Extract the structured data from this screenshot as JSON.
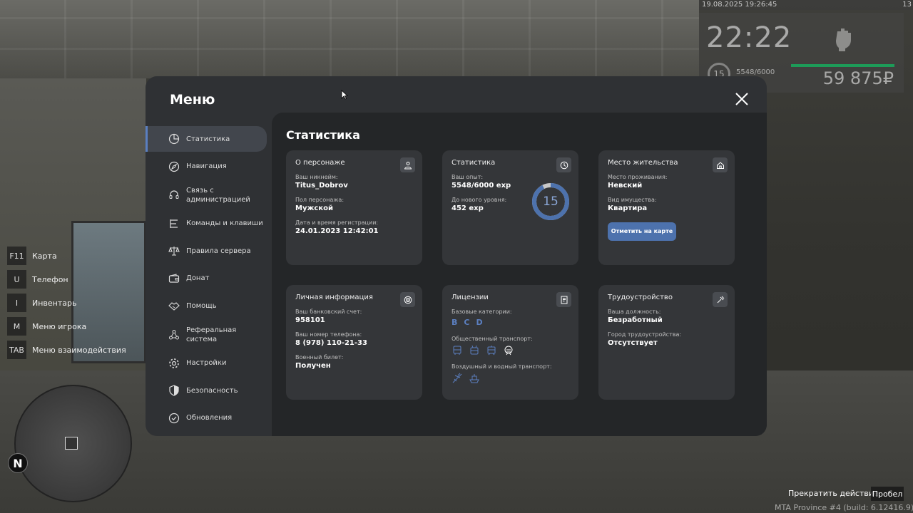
{
  "hud": {
    "datetime": "19.08.2025 19:26:45",
    "edge_num": "13",
    "time": "22:22",
    "level": "15",
    "exp": "5548/6000",
    "money": "59 875₽"
  },
  "keybinds": [
    {
      "key": "F11",
      "label": "Карта"
    },
    {
      "key": "U",
      "label": "Телефон"
    },
    {
      "key": "I",
      "label": "Инвентарь"
    },
    {
      "key": "M",
      "label": "Меню игрока"
    },
    {
      "key": "TAB",
      "label": "Меню взаимодействия"
    }
  ],
  "compass": "N",
  "action": {
    "label": "Прекратить действие",
    "key": "Пробел"
  },
  "build": "MTA Province #4 (build: 6.12416.9)",
  "menu": {
    "title": "Меню",
    "nav": [
      {
        "label": "Статистика",
        "icon": "pie-chart-icon"
      },
      {
        "label": "Навигация",
        "icon": "compass-icon"
      },
      {
        "label": "Связь с администрацией",
        "icon": "headset-icon"
      },
      {
        "label": "Команды и клавиши",
        "icon": "list-icon"
      },
      {
        "label": "Правила сервера",
        "icon": "scales-icon"
      },
      {
        "label": "Донат",
        "icon": "wallet-icon"
      },
      {
        "label": "Помощь",
        "icon": "handshake-icon"
      },
      {
        "label": "Реферальная система",
        "icon": "network-icon"
      },
      {
        "label": "Настройки",
        "icon": "gear-icon"
      },
      {
        "label": "Безопасность",
        "icon": "shield-icon"
      },
      {
        "label": "Обновления",
        "icon": "check-circle-icon"
      }
    ],
    "content_title": "Статистика",
    "cards": {
      "character": {
        "title": "О персонаже",
        "fields": [
          {
            "label": "Ваш никнейм:",
            "value": "Titus_Dobrov"
          },
          {
            "label": "Пол персонажа:",
            "value": "Мужской"
          },
          {
            "label": "Дата и время регистрации:",
            "value": "24.01.2023 12:42:01"
          }
        ]
      },
      "stats": {
        "title": "Статистика",
        "fields": [
          {
            "label": "Ваш опыт:",
            "value": "5548/6000 exp"
          },
          {
            "label": "До нового уровня:",
            "value": "452 exp"
          }
        ],
        "level": "15",
        "progress": 0.925
      },
      "residence": {
        "title": "Место жительства",
        "fields": [
          {
            "label": "Место проживания:",
            "value": "Невский"
          },
          {
            "label": "Вид имущества:",
            "value": "Квартира"
          }
        ],
        "button": "Отметить на карте"
      },
      "personal": {
        "title": "Личная информация",
        "fields": [
          {
            "label": "Ваш банковский счет:",
            "value": "958101"
          },
          {
            "label": "Ваш номер телефона:",
            "value": "8 (978) 110-21-33"
          },
          {
            "label": "Военный билет:",
            "value": "Получен"
          }
        ]
      },
      "licenses": {
        "title": "Лицензии",
        "base_label": "Базовые категории:",
        "base": [
          "B",
          "C",
          "D"
        ],
        "public_label": "Общественный транспорт:",
        "air_label": "Воздушный и водный транспорт:"
      },
      "employment": {
        "title": "Трудоустройство",
        "fields": [
          {
            "label": "Ваша должность:",
            "value": "Безработный"
          },
          {
            "label": "Город трудоустройства:",
            "value": "Отсутствует"
          }
        ]
      }
    }
  },
  "colors": {
    "accent": "#5a7fc0",
    "button": "#4d72ad",
    "exp_bar": "#1d9b58"
  }
}
